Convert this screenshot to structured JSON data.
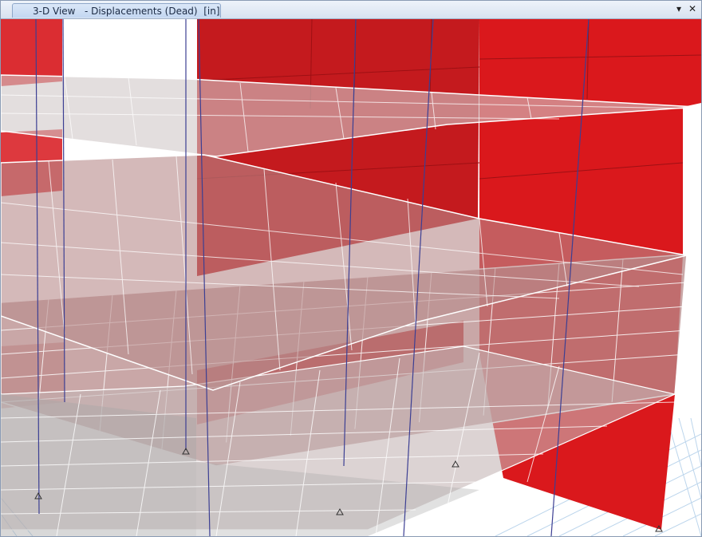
{
  "window": {
    "tab_title": "3-D View   - Displacements (Dead)  [in]",
    "dropdown_icon": "triangle-down-icon",
    "close_icon": "close-icon"
  },
  "viewport": {
    "colors": {
      "wall": "#d7161c",
      "slab": "#e3d6d6",
      "mesh": "#ffffff",
      "column": "#3c3f93",
      "grid": "#bcd5ec"
    }
  }
}
